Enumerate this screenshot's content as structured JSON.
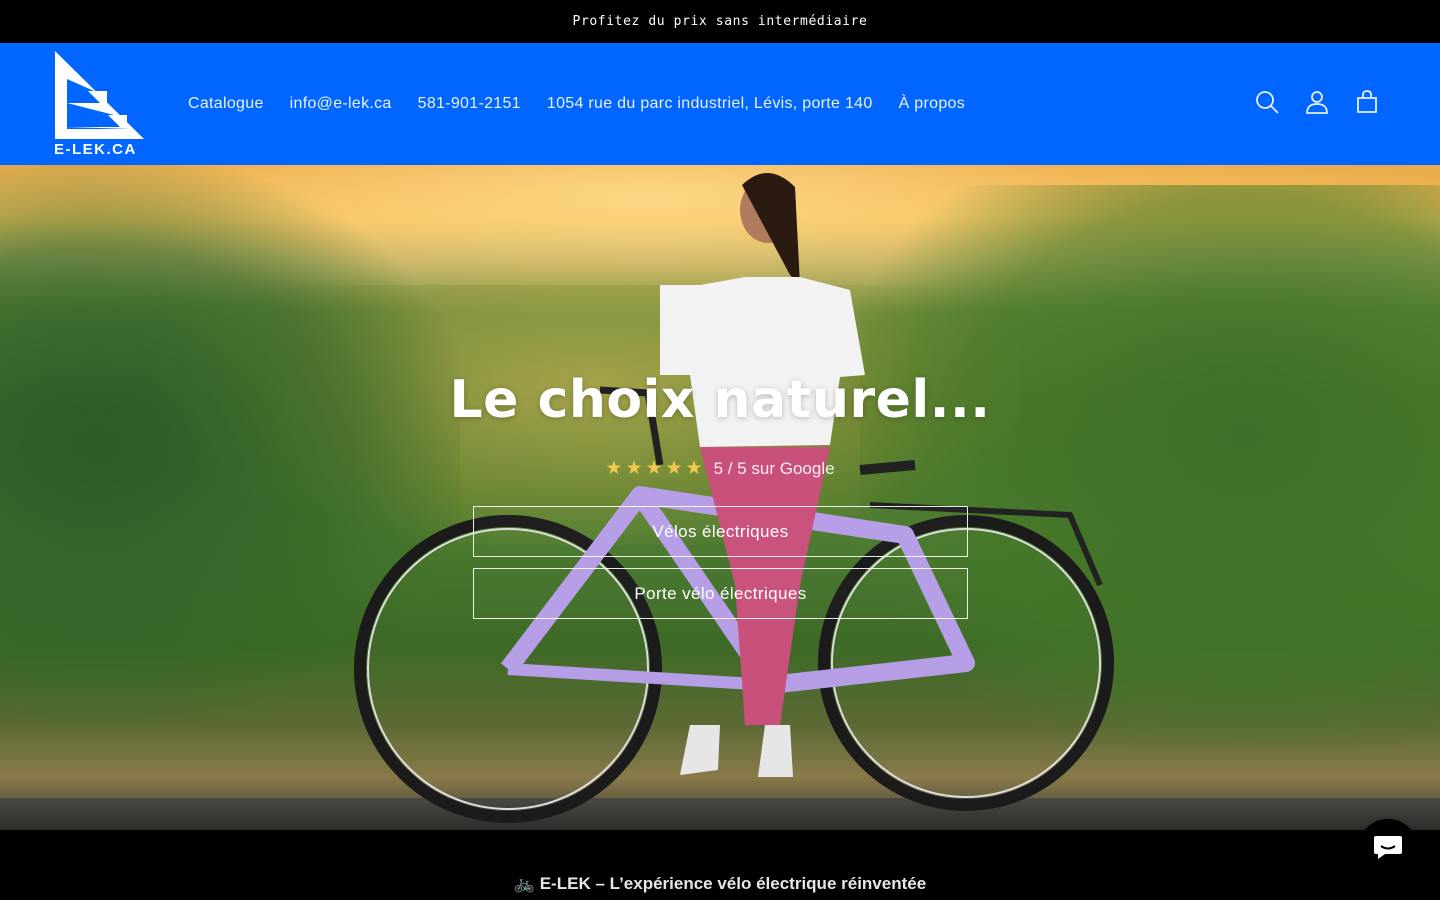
{
  "announcement": {
    "text": "Profitez du prix sans intermédiaire"
  },
  "brand": {
    "logo_text": "E-LEK.CA",
    "color": "#0066ff"
  },
  "nav": {
    "items": [
      {
        "label": "Catalogue"
      },
      {
        "label": "info@e-lek.ca"
      },
      {
        "label": "581-901-2151"
      },
      {
        "label": "1054 rue du parc industriel, Lévis, porte 140"
      },
      {
        "label": "À propos"
      }
    ]
  },
  "header_icons": [
    "search-icon",
    "account-icon",
    "cart-icon"
  ],
  "hero": {
    "title": "Le choix naturel...",
    "rating": {
      "stars": "★★★★★",
      "text": "5 / 5 sur Google"
    },
    "buttons": [
      {
        "label": "Vélos électriques"
      },
      {
        "label": "Porte vélo électriques"
      }
    ]
  },
  "footer_band": {
    "tagline": "🚲 E-LEK – L’expérience vélo électrique réinventée"
  },
  "chat": {
    "icon": "chat-icon"
  }
}
